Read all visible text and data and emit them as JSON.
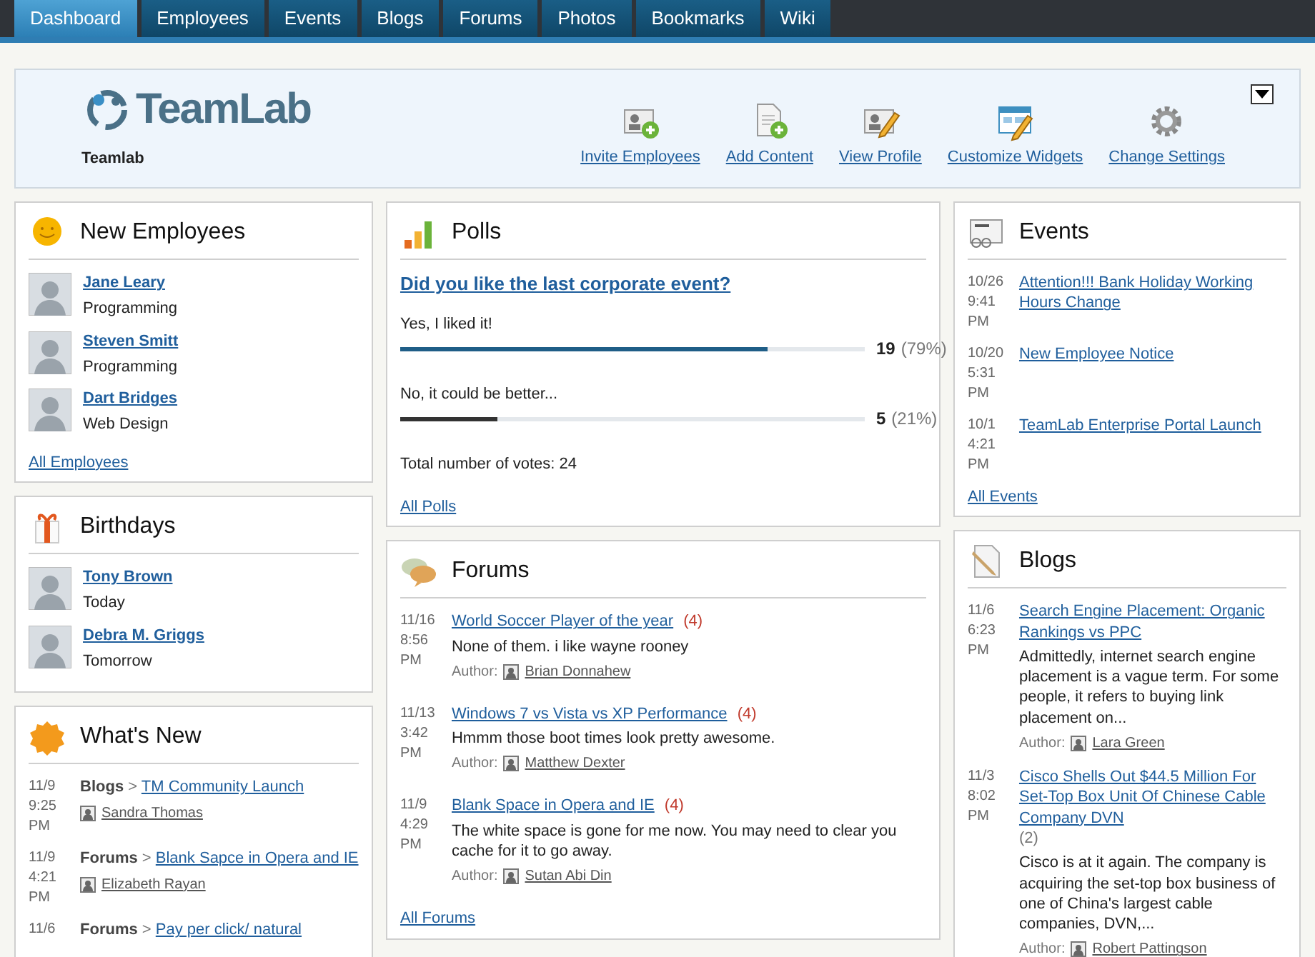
{
  "nav_tabs": [
    {
      "label": "Dashboard",
      "selected": true
    },
    {
      "label": "Employees",
      "selected": false
    },
    {
      "label": "Events",
      "selected": false
    },
    {
      "label": "Blogs",
      "selected": false
    },
    {
      "label": "Forums",
      "selected": false
    },
    {
      "label": "Photos",
      "selected": false
    },
    {
      "label": "Bookmarks",
      "selected": false
    },
    {
      "label": "Wiki",
      "selected": false
    }
  ],
  "header": {
    "logo_text": "TeamLab",
    "site_name": "Teamlab",
    "actions": [
      {
        "label": "Invite Employees",
        "kind": "invite"
      },
      {
        "label": "Add Content",
        "kind": "add"
      },
      {
        "label": "View Profile",
        "kind": "profile"
      },
      {
        "label": "Customize Widgets",
        "kind": "widgets"
      },
      {
        "label": "Change Settings",
        "kind": "settings"
      }
    ]
  },
  "new_employees": {
    "title": "New Employees",
    "people": [
      {
        "name": "Jane Leary",
        "department": "Programming"
      },
      {
        "name": "Steven Smitt",
        "department": "Programming"
      },
      {
        "name": "Dart Bridges",
        "department": "Web Design"
      }
    ],
    "footer_link": "All Employees"
  },
  "birthdays": {
    "title": "Birthdays",
    "people": [
      {
        "name": "Tony Brown",
        "when": "Today"
      },
      {
        "name": "Debra M. Griggs",
        "when": "Tomorrow"
      }
    ]
  },
  "whats_new": {
    "title": "What's New",
    "items": [
      {
        "date": "11/9",
        "time": "9:25",
        "meridiem": "PM",
        "section": "Blogs",
        "separator": ">",
        "link": "TM Community Launch",
        "author": "Sandra Thomas"
      },
      {
        "date": "11/9",
        "time": "4:21",
        "meridiem": "PM",
        "section": "Forums",
        "separator": ">",
        "link": "Blank Sapce in Opera and IE",
        "author": "Elizabeth Rayan"
      },
      {
        "date": "11/6",
        "section": "Forums",
        "separator": ">",
        "link": "Pay per click/ natural"
      }
    ]
  },
  "polls": {
    "title": "Polls",
    "question": "Did you like the last corporate event?",
    "options": [
      {
        "label": "Yes, I liked it!",
        "level": 0.79,
        "count": "19",
        "percent": "(79%)"
      },
      {
        "label": "No, it could be better...",
        "level": 0.21,
        "count": "5",
        "percent": "(21%)"
      }
    ],
    "total": "Total number of votes: 24",
    "footer_link": "All Polls"
  },
  "forums": {
    "title": "Forums",
    "topics": [
      {
        "date": "11/16",
        "time": "8:56",
        "meridiem": "PM",
        "title": "World Soccer Player of the year",
        "count": "(4)",
        "excerpt": "None of them. i like wayne rooney",
        "author_label": "Author:",
        "author": "Brian Donnahew"
      },
      {
        "date": "11/13",
        "time": "3:42",
        "meridiem": "PM",
        "title": "Windows 7 vs Vista vs XP Performance",
        "count": "(4)",
        "excerpt": "Hmmm those boot times look pretty awesome.",
        "author_label": "Author:",
        "author": "Matthew Dexter"
      },
      {
        "date": "11/9",
        "time": "4:29",
        "meridiem": "PM",
        "title": "Blank Space in Opera and IE",
        "count": "(4)",
        "excerpt": "The white space is gone for me now. You may need to clear you cache for it to go away.",
        "author_label": "Author:",
        "author": "Sutan Abi Din"
      }
    ],
    "footer_link": "All Forums"
  },
  "events": {
    "title": "Events",
    "items": [
      {
        "date": "10/26",
        "time": "9:41",
        "meridiem": "PM",
        "title": "Attention!!! Bank Holiday Working Hours Change"
      },
      {
        "date": "10/20",
        "time": "5:31",
        "meridiem": "PM",
        "title": "New Employee Notice"
      },
      {
        "date": "10/1",
        "time": "4:21",
        "meridiem": "PM",
        "title": "TeamLab Enterprise Portal Launch"
      }
    ],
    "footer_link": "All Events"
  },
  "blogs": {
    "title": "Blogs",
    "posts": [
      {
        "date": "11/6",
        "time": "6:23",
        "meridiem": "PM",
        "title": "Search Engine Placement: Organic Rankings vs PPC",
        "excerpt": "Admittedly, internet search engine placement is a vague term. For some people, it refers to buying link placement on...",
        "author_label": "Author:",
        "author": "Lara Green"
      },
      {
        "date": "11/3",
        "time": "8:02",
        "meridiem": "PM",
        "title": "Cisco Shells Out $44.5 Million For Set-Top Box Unit Of Chinese Cable Company DVN",
        "count": "(2)",
        "excerpt": "Cisco is at it again. The company is acquiring the set-top box business of one of China's largest cable companies, DVN,...",
        "author_label": "Author:",
        "author": "Robert Pattingson"
      }
    ]
  }
}
